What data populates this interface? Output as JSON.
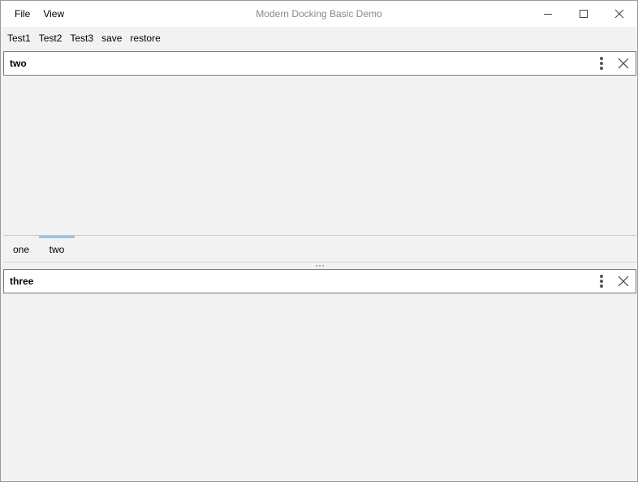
{
  "window": {
    "title": "Modern Docking Basic Demo"
  },
  "menu": {
    "file": "File",
    "view": "View"
  },
  "toolbar": {
    "items": [
      "Test1",
      "Test2",
      "Test3",
      "save",
      "restore"
    ]
  },
  "top_panel": {
    "title": "two",
    "tabs": [
      {
        "label": "one",
        "active": false
      },
      {
        "label": "two",
        "active": true
      }
    ]
  },
  "bottom_panel": {
    "title": "three"
  },
  "colors": {
    "active_tab_indicator": "#9cc3e6"
  }
}
